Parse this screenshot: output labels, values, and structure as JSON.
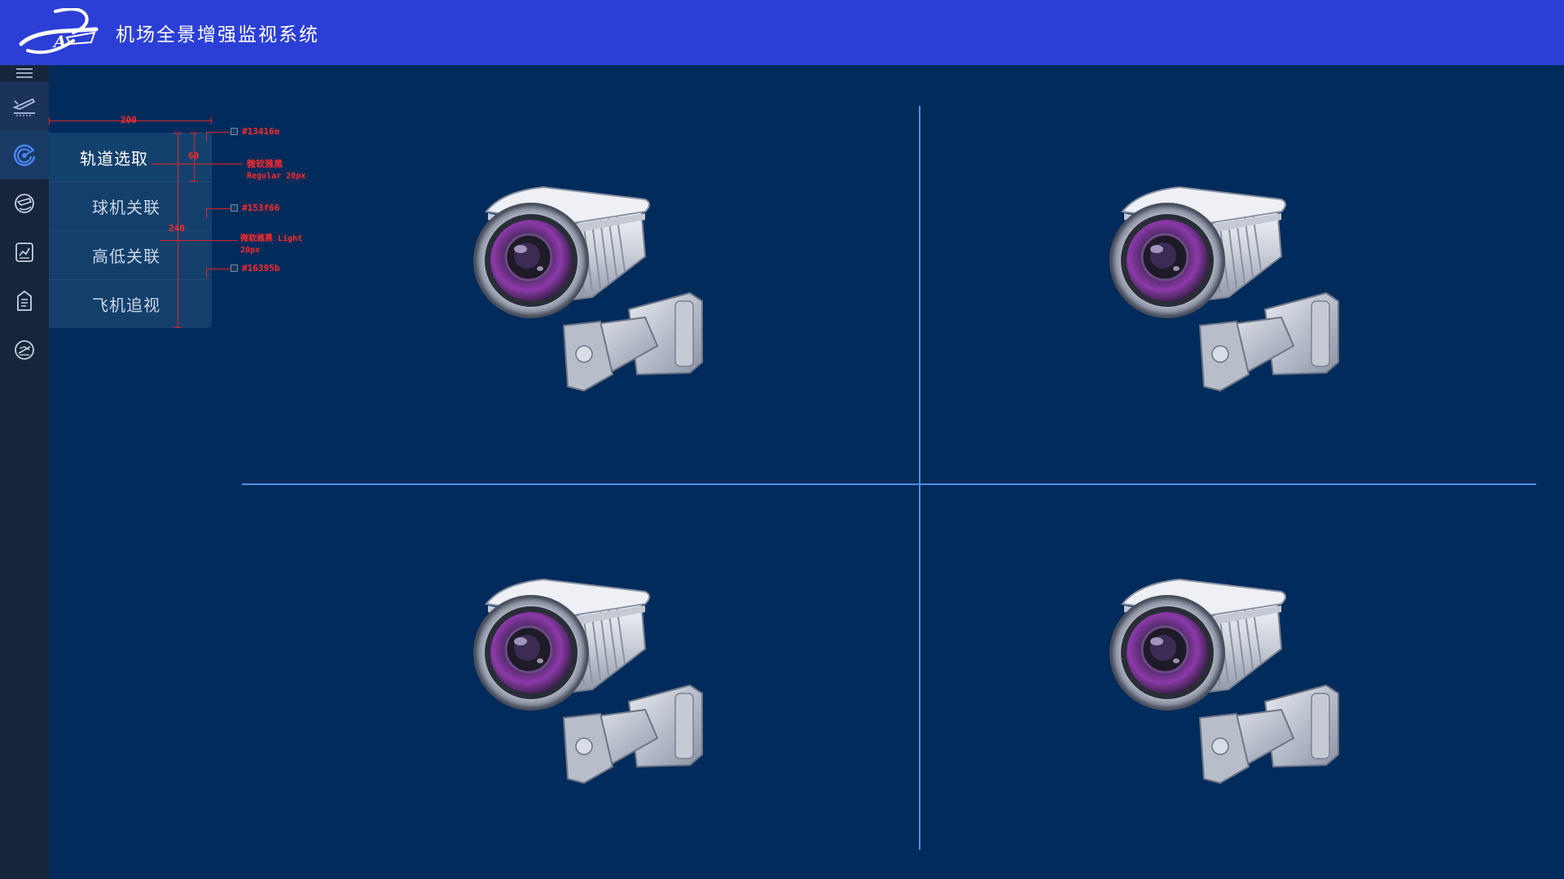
{
  "header": {
    "title": "机场全景增强监视系统",
    "bg_color": "#2b3fd6"
  },
  "rail": {
    "menu_icon": "hamburger-icon",
    "items": [
      {
        "icon": "runway-landing-icon"
      },
      {
        "icon": "radar-icon"
      },
      {
        "icon": "camera-link-icon"
      },
      {
        "icon": "chart-icon"
      },
      {
        "icon": "document-icon"
      },
      {
        "icon": "no-fly-icon"
      }
    ]
  },
  "submenu": {
    "items": [
      {
        "label": "轨道选取",
        "selected": true
      },
      {
        "label": "球机关联",
        "selected": false
      },
      {
        "label": "高低关联",
        "selected": false
      },
      {
        "label": "飞机追视",
        "selected": false
      }
    ]
  },
  "annotations": {
    "width_label": "200",
    "item_height_label": "60",
    "menu_height_label": "240",
    "color_selected": "#13416e",
    "color_item": "#153f66",
    "color_menu": "#16395b",
    "font_selected_1": "微软雅黑",
    "font_selected_2": "Regular 20px",
    "font_item_1": "微软雅黑 Light",
    "font_item_2": "20px"
  },
  "video_grid": {
    "cameras": [
      {
        "icon": "cctv-camera-icon"
      },
      {
        "icon": "cctv-camera-icon"
      },
      {
        "icon": "cctv-camera-icon"
      },
      {
        "icon": "cctv-camera-icon"
      }
    ]
  }
}
